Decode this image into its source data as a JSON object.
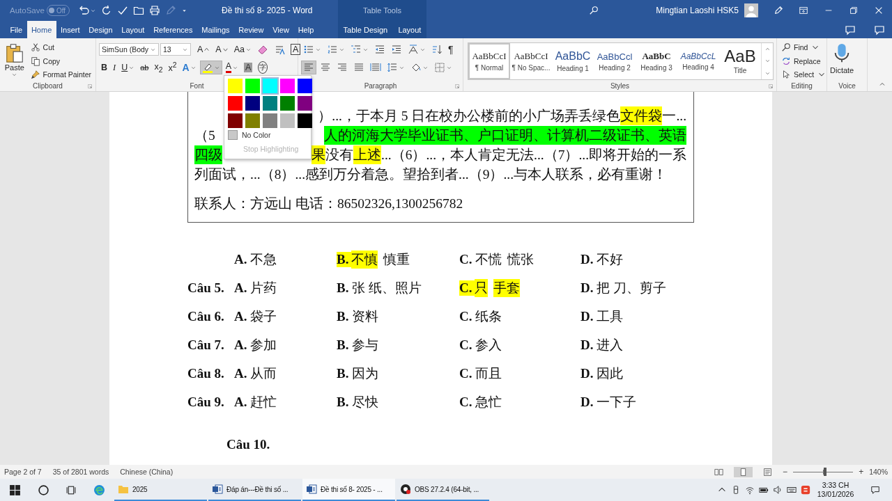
{
  "title_bar": {
    "autosave_label": "AutoSave",
    "autosave_toggle": {
      "label": "Off",
      "on": false
    },
    "quick_access": [
      {
        "kind": "undo",
        "dropdown": true
      },
      {
        "kind": "redo"
      },
      {
        "kind": "spelling"
      },
      {
        "kind": "open"
      },
      {
        "kind": "print"
      },
      {
        "kind": "pen",
        "disabled": true
      },
      {
        "kind": "customize"
      }
    ],
    "title": "Đề thi số 8- 2025 - Word",
    "context_label": "Table Tools",
    "user": "Mingtian Laoshi HSK5"
  },
  "tabs": [
    {
      "label": "File",
      "selected": false,
      "contextual": false
    },
    {
      "label": "Home",
      "selected": true,
      "contextual": false
    },
    {
      "label": "Insert",
      "selected": false,
      "contextual": false
    },
    {
      "label": "Design",
      "selected": false,
      "contextual": false
    },
    {
      "label": "Layout",
      "selected": false,
      "contextual": false
    },
    {
      "label": "References",
      "selected": false,
      "contextual": false
    },
    {
      "label": "Mailings",
      "selected": false,
      "contextual": false
    },
    {
      "label": "Review",
      "selected": false,
      "contextual": false
    },
    {
      "label": "View",
      "selected": false,
      "contextual": false
    },
    {
      "label": "Help",
      "selected": false,
      "contextual": false
    },
    {
      "label": "Table Design",
      "selected": false,
      "contextual": true
    },
    {
      "label": "Layout",
      "selected": false,
      "contextual": true
    }
  ],
  "ribbon": [
    {
      "kind": "clipboard",
      "label": "Clipboard",
      "launcher": true,
      "paste": {
        "label": "Paste",
        "dropdown": true
      },
      "commands": [
        {
          "kind": "cut",
          "label": "Cut"
        },
        {
          "kind": "copy",
          "label": "Copy"
        },
        {
          "kind": "painter",
          "label": "Format Painter"
        }
      ]
    },
    {
      "kind": "font",
      "label": "Font",
      "font_name": "SimSun (Body",
      "font_size": "13",
      "rows": [
        [
          {
            "kind": "grow",
            "label": "A"
          },
          {
            "kind": "shrink",
            "label": "A"
          },
          {
            "kind": "case",
            "label": "Aa",
            "dropdown": true
          },
          {
            "kind": "clear"
          },
          {
            "kind": "phonetic"
          },
          {
            "kind": "boxed",
            "label": "A"
          }
        ],
        [
          {
            "kind": "bold",
            "label": "B"
          },
          {
            "kind": "italic",
            "label": "I"
          },
          {
            "kind": "underline",
            "label": "U",
            "dropdown": true
          },
          {
            "kind": "strike",
            "label": "ab"
          },
          {
            "kind": "subscript",
            "label": "x$_{2}$"
          },
          {
            "kind": "superscript",
            "label": "x$^{2}$"
          },
          {
            "kind": "effects",
            "label": "A",
            "dropdown": true
          },
          {
            "kind": "highlight",
            "dropdown": true,
            "pressed": true
          },
          {
            "kind": "fontcolor",
            "label": "A",
            "dropdown": true
          },
          {
            "kind": "shading",
            "label": "A"
          },
          {
            "kind": "enclose",
            "label": "字"
          }
        ]
      ]
    },
    {
      "kind": "paragraph",
      "label": "Paragraph",
      "launcher": true,
      "rows": [
        [
          {
            "kind": "bullets",
            "dropdown": true
          },
          {
            "kind": "numbering",
            "dropdown": true
          },
          {
            "kind": "multilevel",
            "dropdown": true
          },
          {
            "kind": "outdent"
          },
          {
            "kind": "indent"
          },
          {
            "kind": "asian",
            "dropdown": true
          },
          {
            "kind": "sort"
          },
          {
            "kind": "marks",
            "label": "¶"
          }
        ],
        [
          {
            "kind": "left",
            "pressed": true
          },
          {
            "kind": "center",
            "pressed": false
          },
          {
            "kind": "right",
            "pressed": false
          },
          {
            "kind": "justify",
            "pressed": false
          },
          {
            "kind": "distribute",
            "pressed": false
          },
          {
            "kind": "spacing",
            "dropdown": true
          },
          {
            "kind": "fill",
            "dropdown": true
          },
          {
            "kind": "borders",
            "dropdown": true
          }
        ]
      ]
    },
    {
      "kind": "styles",
      "label": "Styles",
      "launcher": true,
      "gallery": [
        {
          "kind": "normal",
          "preview": "AaBbCcI",
          "name": "¶ Normal",
          "selected": true
        },
        {
          "kind": "nospacing",
          "preview": "AaBbCcI",
          "name": "¶ No Spac...",
          "selected": false
        },
        {
          "kind": "heading1",
          "preview": "AaBbC",
          "name": "Heading 1",
          "selected": false
        },
        {
          "kind": "heading2",
          "preview": "AaBbCcl",
          "name": "Heading 2",
          "selected": false
        },
        {
          "kind": "heading3",
          "preview": "AaBbC",
          "name": "Heading 3",
          "selected": false
        },
        {
          "kind": "heading4",
          "preview": "AaBbCcL",
          "name": "Heading 4",
          "selected": false
        },
        {
          "kind": "title",
          "preview": "AaB",
          "name": "Title",
          "selected": false
        }
      ]
    },
    {
      "kind": "editing",
      "label": "Editing",
      "commands": [
        {
          "kind": "find",
          "label": "Find",
          "dropdown": true
        },
        {
          "kind": "replace",
          "label": "Replace"
        },
        {
          "kind": "select",
          "label": "Select",
          "dropdown": true
        }
      ]
    },
    {
      "kind": "voice",
      "label": "Voice",
      "commands": [
        {
          "kind": "dictate",
          "label": "Dictate"
        }
      ]
    }
  ],
  "highlight_menu": {
    "colors": [
      {
        "color": "#ffff00",
        "hovered": false
      },
      {
        "color": "#00ff00",
        "hovered": false
      },
      {
        "color": "#00ffff",
        "hovered": true
      },
      {
        "color": "#ff00ff",
        "hovered": false
      },
      {
        "color": "#0000ff",
        "hovered": false
      },
      {
        "color": "#ff0000",
        "hovered": false
      },
      {
        "color": "#000080",
        "hovered": false
      },
      {
        "color": "#008080",
        "hovered": false
      },
      {
        "color": "#008000",
        "hovered": false
      },
      {
        "color": "#800080",
        "hovered": false
      },
      {
        "color": "#800000",
        "hovered": false
      },
      {
        "color": "#808000",
        "hovered": false
      },
      {
        "color": "#808080",
        "hovered": false
      },
      {
        "color": "#c0c0c0",
        "hovered": false
      },
      {
        "color": "#000000",
        "hovered": false
      }
    ],
    "items": [
      {
        "label": "No Color",
        "disabled": false
      },
      {
        "label": "Stop Highlighting",
        "disabled": true
      }
    ]
  },
  "document": {
    "paragraphs": [
      {
        "lines": [
          {
            "runs": [
              {
                "kind": "covered"
              },
              {
                "text": "）...，于本月 5 日在校办公楼前的小广场弄丢绿色"
              },
              {
                "text": "文件袋",
                "color": "#ffff00"
              },
              {
                "text": "一..."
              }
            ]
          },
          {
            "runs": [
              {
                "text": "（5"
              },
              {
                "kind": "covered"
              },
              {
                "text": "人的河海大学毕业证书、户口证明、计算机二级证书、英语",
                "color": "#00ff00"
              }
            ]
          },
          {
            "runs": [
              {
                "text": "四级",
                "color": "#00ff00"
              },
              {
                "kind": "covered"
              },
              {
                "text": "果",
                "color": "#ffff00"
              },
              {
                "text": "没有"
              },
              {
                "text": "上述",
                "color": "#ffff00"
              },
              {
                "text": "...（6）...，本人肯定无法...（7）...即将开始的一系"
              }
            ]
          },
          {
            "runs": [
              {
                "text": "列面试，...（8）...感到万分着急。望拾到者...（9）...与本人联系，必有重谢！"
              }
            ]
          }
        ]
      },
      {
        "lines": [
          {
            "runs": [
              {
                "text": "联系人：方远山  电话：86502326,1300256782"
              }
            ]
          }
        ]
      }
    ],
    "answers": [
      {
        "options": [
          {
            "letter": "A.",
            "runs": [
              {
                "text": "不急"
              }
            ]
          },
          {
            "letter": "B.",
            "color": "#ffff00",
            "runs": [
              {
                "text": "不慎",
                "color": "#ffff00"
              },
              {
                "text": "慎重"
              }
            ]
          },
          {
            "letter": "C.",
            "runs": [
              {
                "text": "不慌"
              },
              {
                "text": "慌张"
              }
            ]
          },
          {
            "letter": "D.",
            "runs": [
              {
                "text": "不好"
              }
            ]
          }
        ]
      },
      {
        "label": "Câu 5.",
        "options": [
          {
            "letter": "A.",
            "runs": [
              {
                "text": "片药"
              }
            ]
          },
          {
            "letter": "B.",
            "runs": [
              {
                "text": "张 纸、照片"
              }
            ]
          },
          {
            "letter": "C.",
            "color": "#ffff00",
            "runs": [
              {
                "text": "只",
                "color": "#ffff00"
              },
              {
                "text": "手套",
                "color": "#ffff00"
              }
            ]
          },
          {
            "letter": "D.",
            "runs": [
              {
                "text": "把 刀、剪子"
              }
            ]
          }
        ]
      },
      {
        "label": "Câu 6.",
        "options": [
          {
            "letter": "A.",
            "runs": [
              {
                "text": "袋子"
              }
            ]
          },
          {
            "letter": "B.",
            "runs": [
              {
                "text": "资料"
              }
            ]
          },
          {
            "letter": "C.",
            "runs": [
              {
                "text": "纸条"
              }
            ]
          },
          {
            "letter": "D.",
            "runs": [
              {
                "text": "工具"
              }
            ]
          }
        ]
      },
      {
        "label": "Câu 7.",
        "options": [
          {
            "letter": "A.",
            "runs": [
              {
                "text": "参加"
              }
            ]
          },
          {
            "letter": "B.",
            "runs": [
              {
                "text": "参与"
              }
            ]
          },
          {
            "letter": "C.",
            "runs": [
              {
                "text": "参入"
              }
            ]
          },
          {
            "letter": "D.",
            "runs": [
              {
                "text": "进入"
              }
            ]
          }
        ]
      },
      {
        "label": "Câu 8.",
        "options": [
          {
            "letter": "A.",
            "runs": [
              {
                "text": "从而"
              }
            ]
          },
          {
            "letter": "B.",
            "runs": [
              {
                "text": "因为"
              }
            ]
          },
          {
            "letter": "C.",
            "runs": [
              {
                "text": "而且"
              }
            ]
          },
          {
            "letter": "D.",
            "runs": [
              {
                "text": "因此"
              }
            ]
          }
        ]
      },
      {
        "label": "Câu 9.",
        "options": [
          {
            "letter": "A.",
            "runs": [
              {
                "text": "赶忙"
              }
            ]
          },
          {
            "letter": "B.",
            "runs": [
              {
                "text": "尽快"
              }
            ]
          },
          {
            "letter": "C.",
            "runs": [
              {
                "text": "急忙"
              }
            ]
          },
          {
            "letter": "D.",
            "runs": [
              {
                "text": "一下子"
              }
            ]
          }
        ]
      }
    ],
    "next_question": "Câu 10."
  },
  "status_bar": {
    "items": [
      "Page 2 of 7",
      "35 of 2801 words",
      "Chinese (China)"
    ],
    "views": [
      {
        "kind": "read",
        "selected": false
      },
      {
        "kind": "print",
        "selected": true
      },
      {
        "kind": "web",
        "selected": false
      }
    ],
    "zoom_out": "−",
    "zoom": {
      "level": 0.53
    },
    "zoom_in": "+",
    "zoom_label": "140%"
  },
  "taskbar": {
    "pinned": [
      {
        "kind": "start"
      },
      {
        "kind": "search"
      },
      {
        "kind": "taskview"
      },
      {
        "kind": "edge"
      }
    ],
    "apps": [
      {
        "kind": "folder",
        "label": "2025",
        "selected": false
      },
      {
        "kind": "word",
        "label": "Đáp án---Đề thi số ...",
        "selected": false
      },
      {
        "kind": "word",
        "label": "Đề thi số 8- 2025 - ...",
        "selected": true
      },
      {
        "kind": "obs",
        "label": "OBS 27.2.4 (64-bit, ...",
        "selected": false
      }
    ],
    "tray": [
      {
        "kind": "chevron"
      },
      {
        "kind": "usb"
      },
      {
        "kind": "wifi"
      },
      {
        "kind": "battery"
      },
      {
        "kind": "volume"
      },
      {
        "kind": "ime"
      },
      {
        "kind": "sogou"
      }
    ],
    "time": "3:33 CH",
    "date": "13/01/2026"
  }
}
